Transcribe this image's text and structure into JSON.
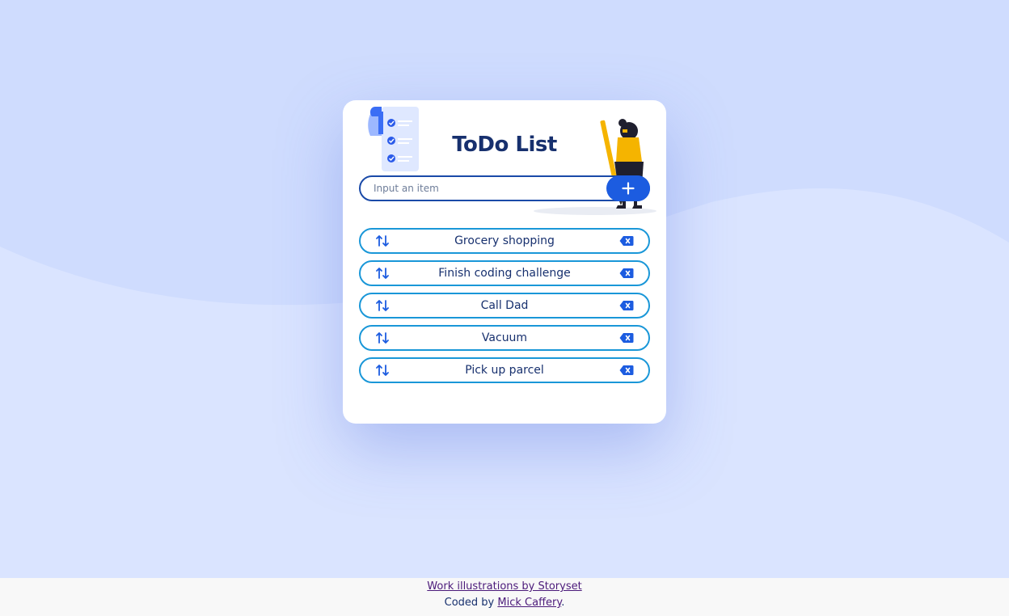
{
  "app": {
    "title": "ToDo List"
  },
  "input": {
    "placeholder": "Input an item",
    "value": ""
  },
  "add_button": {
    "icon": "plus-icon"
  },
  "todos": [
    {
      "text": "Grocery shopping"
    },
    {
      "text": "Finish coding challenge"
    },
    {
      "text": "Call Dad"
    },
    {
      "text": "Vacuum"
    },
    {
      "text": "Pick up parcel"
    }
  ],
  "footer": {
    "credit_link": "Work illustrations by Storyset",
    "coded_by_prefix": "Coded by ",
    "author_link": "Mick Caffery",
    "suffix": "."
  },
  "colors": {
    "background": "#cfdcfe",
    "title": "#17306e",
    "accent": "#1c5ce0",
    "item_border": "#1a97d8"
  }
}
